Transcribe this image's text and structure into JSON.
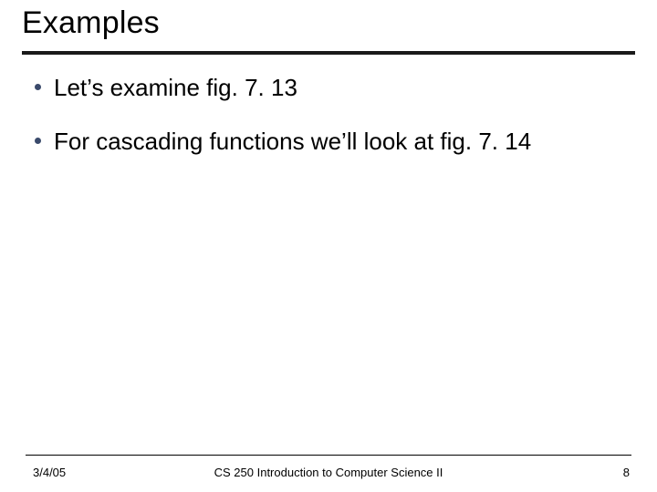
{
  "title": "Examples",
  "bullets": [
    "Let’s examine fig. 7. 13",
    "For cascading functions we’ll look at fig. 7. 14"
  ],
  "footer": {
    "date": "3/4/05",
    "course": "CS 250 Introduction to Computer Science II",
    "page": "8"
  }
}
